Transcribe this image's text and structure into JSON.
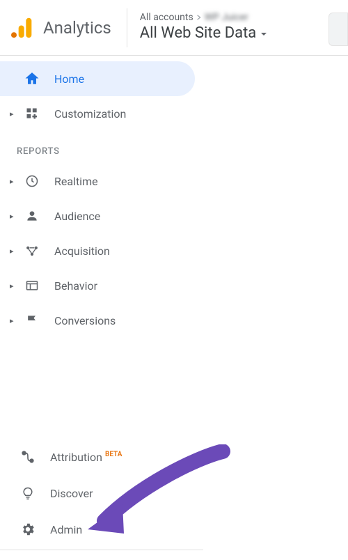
{
  "header": {
    "product_name": "Analytics",
    "account_line": "All accounts",
    "account_blurred": "WP Juicer",
    "view_name": "All Web Site Data"
  },
  "sidebar": {
    "home": "Home",
    "customization": "Customization",
    "reports_label": "REPORTS",
    "realtime": "Realtime",
    "audience": "Audience",
    "acquisition": "Acquisition",
    "behavior": "Behavior",
    "conversions": "Conversions"
  },
  "bottom": {
    "attribution": "Attribution",
    "beta": "BETA",
    "discover": "Discover",
    "admin": "Admin"
  }
}
